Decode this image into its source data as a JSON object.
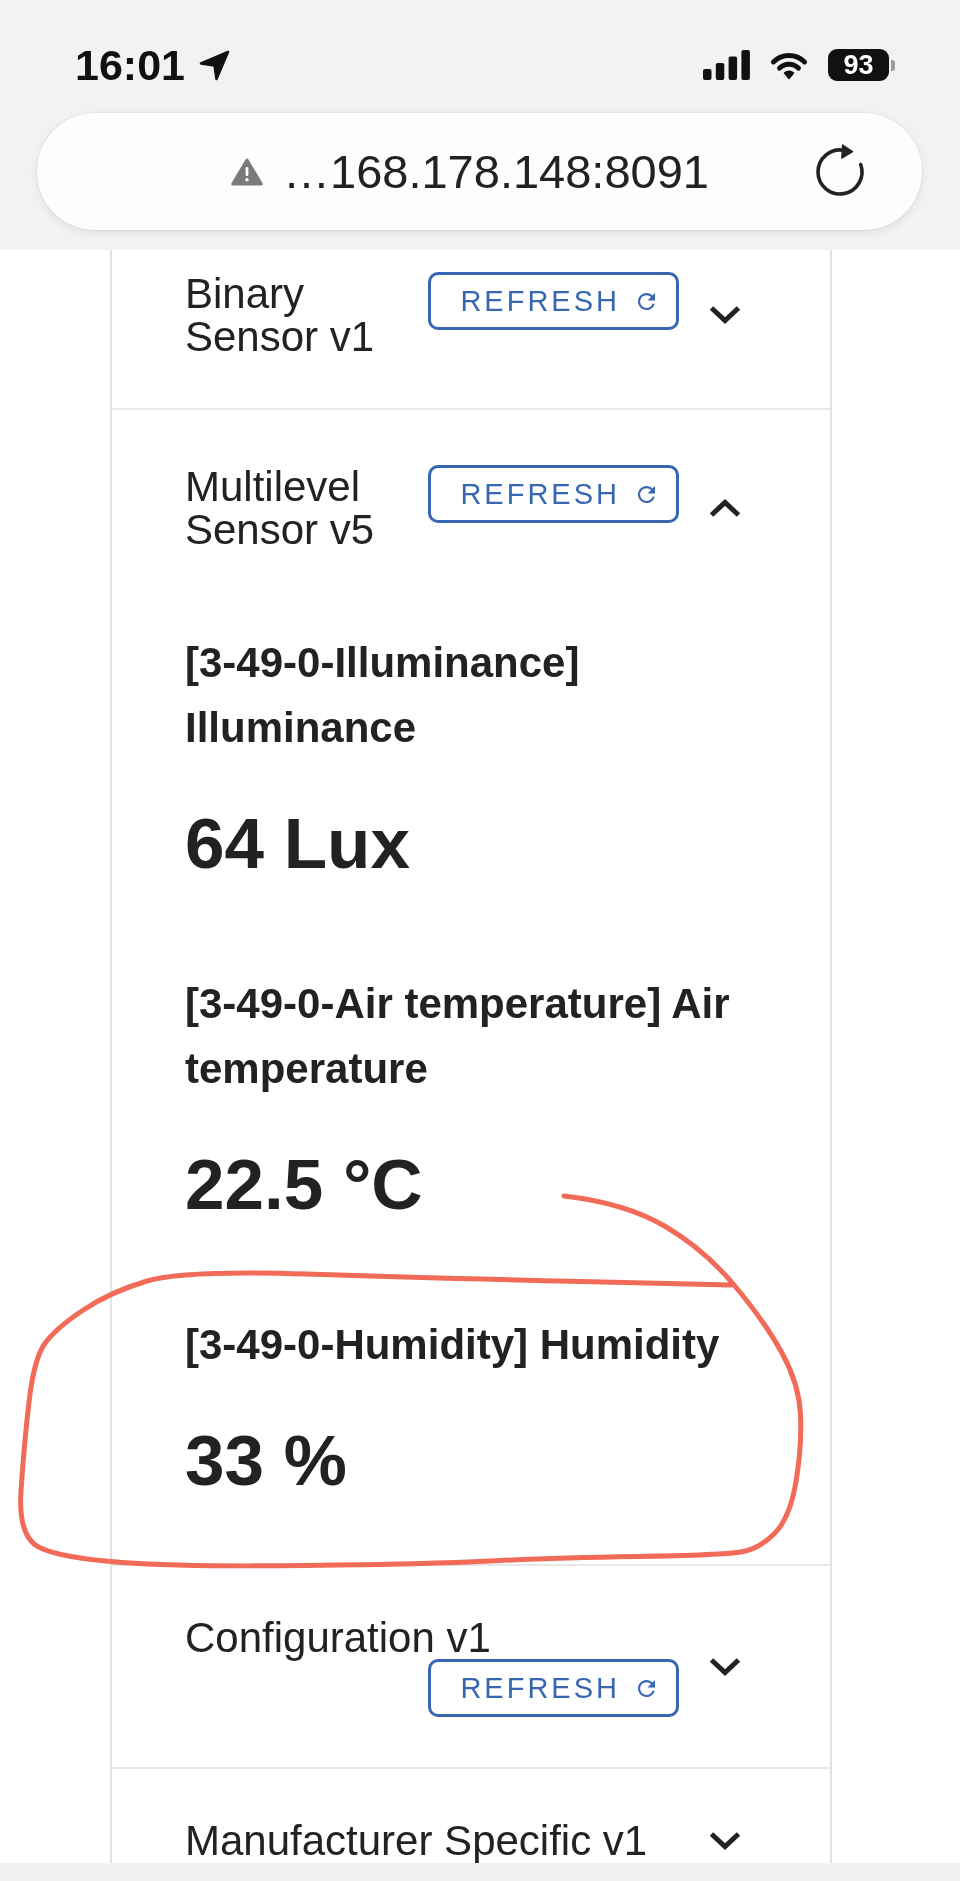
{
  "status_bar": {
    "time": "16:01",
    "battery": "93"
  },
  "address_bar": {
    "url": "…168.178.148:8091",
    "secure": false
  },
  "sections": [
    {
      "title": "Binary Sensor v1",
      "button": "REFRESH",
      "expanded": false
    },
    {
      "title": "Multilevel Sensor v5",
      "button": "REFRESH",
      "expanded": true,
      "readings": [
        {
          "label": "[3-49-0-Illuminance] Illuminance",
          "value": "64 Lux",
          "circled": false
        },
        {
          "label": "[3-49-0-Air temperature] Air temperature",
          "value": "22.5 °C",
          "circled": false
        },
        {
          "label": "[3-49-0-Humidity] Humidity",
          "value": "33 %",
          "circled": true
        }
      ]
    },
    {
      "title": "Configuration v1",
      "button": "REFRESH",
      "expanded": false
    },
    {
      "title": "Manufacturer Specific v1",
      "expanded": false
    }
  ]
}
